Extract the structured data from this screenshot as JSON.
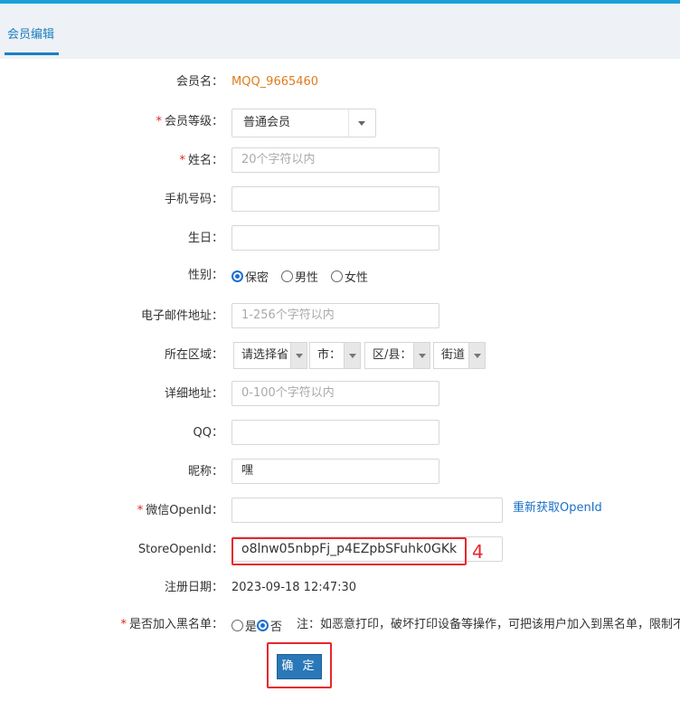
{
  "tab": {
    "label": "会员编辑"
  },
  "form": {
    "member_name": {
      "label": "会员名：",
      "value": "MQQ_9665460"
    },
    "level": {
      "required": "*",
      "label": "会员等级：",
      "value": "普通会员"
    },
    "name": {
      "required": "*",
      "label": "姓名：",
      "placeholder": "20个字符以内",
      "value": ""
    },
    "phone": {
      "label": "手机号码：",
      "value": ""
    },
    "birthday": {
      "label": "生日：",
      "value": ""
    },
    "gender": {
      "label": "性别：",
      "options": [
        "保密",
        "男性",
        "女性"
      ],
      "selected": "保密"
    },
    "email": {
      "label": "电子邮件地址：",
      "placeholder": "1-256个字符以内",
      "value": ""
    },
    "region": {
      "label": "所在区域：",
      "province": "请选择省",
      "city": "市：",
      "district": "区/县：",
      "street": "街道"
    },
    "address": {
      "label": "详细地址：",
      "placeholder": "0-100个字符以内",
      "value": ""
    },
    "qq": {
      "label": "QQ：",
      "value": ""
    },
    "nickname": {
      "label": "昵称：",
      "value": "嘿"
    },
    "wechat_openid": {
      "required": "*",
      "label": "微信OpenId：",
      "value": "",
      "refresh_link": "重新获取OpenId"
    },
    "store_openid": {
      "label": "StoreOpenId：",
      "value": "o8lnw05nbpFj_p4EZpbSFuhk0GKk",
      "annotation": "4"
    },
    "register_date": {
      "label": "注册日期：",
      "value": "2023-09-18 12:47:30"
    },
    "blacklist": {
      "required": "*",
      "label": "是否加入黑名单：",
      "options": [
        "是",
        "否"
      ],
      "selected": "否",
      "note": "注：如恶意打印，破坏打印设备等操作，可把该用户加入到黑名单，限制不能下单"
    },
    "submit_label": "确 定"
  },
  "colors": {
    "accent": "#1b7ec2",
    "button": "#2b78b8",
    "annotation_red": "#e8262c",
    "member_name": "#e07b1c"
  }
}
